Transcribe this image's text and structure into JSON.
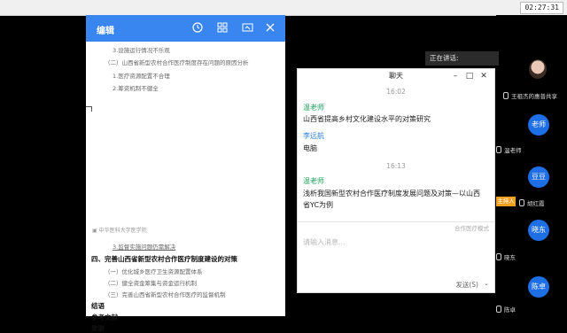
{
  "clock": "02:27:31",
  "editor": {
    "title": "编辑",
    "icons": [
      "timer-icon",
      "grid-icon",
      "screen-icon",
      "close-icon"
    ],
    "doc_lines": [
      "3.设施运行情况不乐观",
      "（二）山西省新型农村合作医疗制度存在问题的原因分析",
      "1.医疗资源配置不合理",
      "2.筹资机制不健全",
      "3.监督实施问题仍需解决",
      "四、完善山西省新型农村合作医疗制度建设的对策",
      "（一）优化城乡医疗卫生资源配置体系",
      "（二）健全资金筹集与资金运行机制",
      "（三）完善山西省新型农村合作医疗的监督机制",
      "结语",
      "参考文献",
      "致谢"
    ],
    "seal_text": "中华医科大学医学院"
  },
  "chat": {
    "title": "聊天",
    "messages": [
      {
        "time": "16:02",
        "sender": "温老师",
        "text": "山西省提高乡村文化建设水平的对策研究"
      },
      {
        "sender": "李远航",
        "text": "电脑"
      },
      {
        "time": "16:13",
        "sender": "温老师",
        "text": "浅析我国新型农村合作医疗制度发展问题及对策—以山西省YC为例"
      }
    ],
    "hint": "合作医疗模式",
    "input_placeholder": "请输入消息...",
    "send_label": "发送(S)"
  },
  "gallery": {
    "speaking_label": "正在讲话:",
    "participants": [
      {
        "name": "王祖杰的惠普共享",
        "avatar": ""
      },
      {
        "name": "温老师",
        "avatar": "老师"
      },
      {
        "name": "胡红霞",
        "avatar": "豆豆"
      },
      {
        "name": "晓东",
        "avatar": "晓东"
      },
      {
        "name": "陈卓",
        "avatar": "陈卓"
      }
    ],
    "host_label": "主持人",
    "host_name": "温老师"
  },
  "colors": {
    "editor_header": "#3a86f0",
    "avatar": "#1e6fe6",
    "sender_green": "#19a25b",
    "sender_blue": "#2e7fe0"
  }
}
